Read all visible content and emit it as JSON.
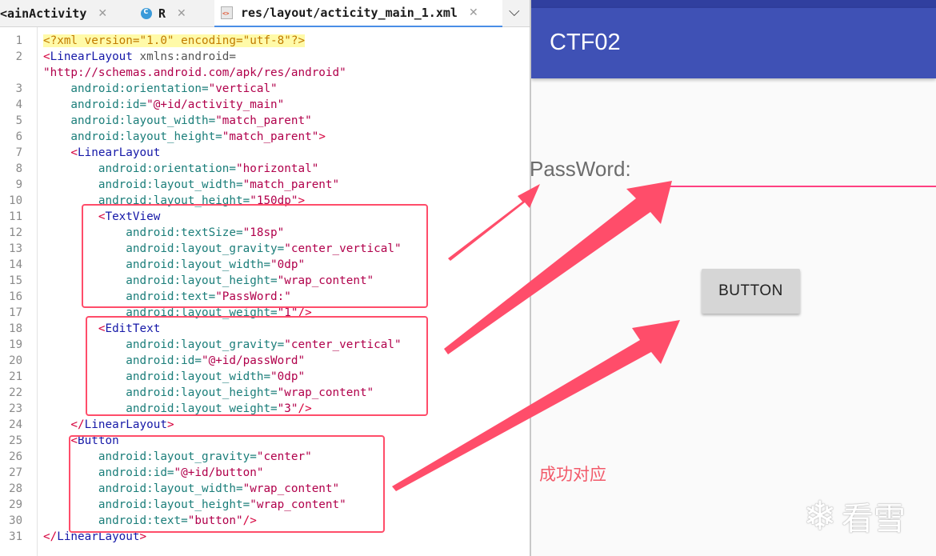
{
  "tabs": [
    {
      "label": "ainActivity",
      "prefix": "<",
      "active": false
    },
    {
      "label": "R",
      "active": false
    },
    {
      "label": "res/layout/acticity_main_1.xml",
      "active": true
    }
  ],
  "code_lines": [
    {
      "n": "1"
    },
    {
      "n": "2"
    },
    {
      "n": ""
    },
    {
      "n": "3"
    },
    {
      "n": "4"
    },
    {
      "n": "5"
    },
    {
      "n": "6"
    },
    {
      "n": "7"
    },
    {
      "n": "8"
    },
    {
      "n": "9"
    },
    {
      "n": "10"
    },
    {
      "n": "11"
    },
    {
      "n": "12"
    },
    {
      "n": "13"
    },
    {
      "n": "14"
    },
    {
      "n": "15"
    },
    {
      "n": "16"
    },
    {
      "n": "17"
    },
    {
      "n": "18"
    },
    {
      "n": "19"
    },
    {
      "n": "20"
    },
    {
      "n": "21"
    },
    {
      "n": "22"
    },
    {
      "n": "23"
    },
    {
      "n": "24"
    },
    {
      "n": "25"
    },
    {
      "n": "26"
    },
    {
      "n": "27"
    },
    {
      "n": "28"
    },
    {
      "n": "29"
    },
    {
      "n": "30"
    },
    {
      "n": "31"
    }
  ],
  "code": {
    "l1": "<?xml version=\"1.0\" encoding=\"utf-8\"?>",
    "l2a": "<",
    "l2b": "LinearLayout",
    "l2c": " xmlns:android=",
    "l2d": "\"http://schemas.android.com/apk/res/android\"",
    "l3a": "    android:orientation=",
    "l3b": "\"vertical\"",
    "l4a": "    android:id=",
    "l4b": "\"@+id/activity_main\"",
    "l5a": "    android:layout_width=",
    "l5b": "\"match_parent\"",
    "l6a": "    android:layout_height=",
    "l6b": "\"match_parent\"",
    "l6c": ">",
    "l7a": "    <",
    "l7b": "LinearLayout",
    "l8a": "        android:orientation=",
    "l8b": "\"horizontal\"",
    "l9a": "        android:layout_width=",
    "l9b": "\"match_parent\"",
    "l10a": "        android:layout_height=",
    "l10b": "\"150dp\"",
    "l10c": ">",
    "l11a": "        <",
    "l11b": "TextView",
    "l12a": "            android:textSize=",
    "l12b": "\"18sp\"",
    "l13a": "            android:layout_gravity=",
    "l13b": "\"center_vertical\"",
    "l14a": "            android:layout_width=",
    "l14b": "\"0dp\"",
    "l15a": "            android:layout_height=",
    "l15b": "\"wrap_content\"",
    "l16a": "            android:text=",
    "l16b": "\"PassWord:\"",
    "l17a": "            android:layout_weight=",
    "l17b": "\"1\"",
    "l17c": "/>",
    "l18a": "        <",
    "l18b": "EditText",
    "l19a": "            android:layout_gravity=",
    "l19b": "\"center_vertical\"",
    "l20a": "            android:id=",
    "l20b": "\"@+id/passWord\"",
    "l21a": "            android:layout_width=",
    "l21b": "\"0dp\"",
    "l22a": "            android:layout_height=",
    "l22b": "\"wrap_content\"",
    "l23a": "            android:layout_weight=",
    "l23b": "\"3\"",
    "l23c": "/>",
    "l24a": "    </",
    "l24b": "LinearLayout",
    "l24c": ">",
    "l25a": "    <",
    "l25b": "Button",
    "l26a": "        android:layout_gravity=",
    "l26b": "\"center\"",
    "l27a": "        android:id=",
    "l27b": "\"@+id/button\"",
    "l28a": "        android:layout_width=",
    "l28b": "\"wrap_content\"",
    "l29a": "        android:layout_height=",
    "l29b": "\"wrap_content\"",
    "l30a": "        android:text=",
    "l30b": "\"button\"",
    "l30c": "/>",
    "l31a": "</",
    "l31b": "LinearLayout",
    "l31c": ">"
  },
  "device": {
    "app_title": "CTF02",
    "password_label": "PassWord:",
    "button_label": "BUTTON",
    "annotation": "成功对应",
    "watermark": "看雪"
  },
  "colors": {
    "app_bar": "#3f51b5",
    "status_bar": "#303f9f",
    "edit_underline": "#ff4081",
    "annotation_red": "#ff4d6a"
  }
}
